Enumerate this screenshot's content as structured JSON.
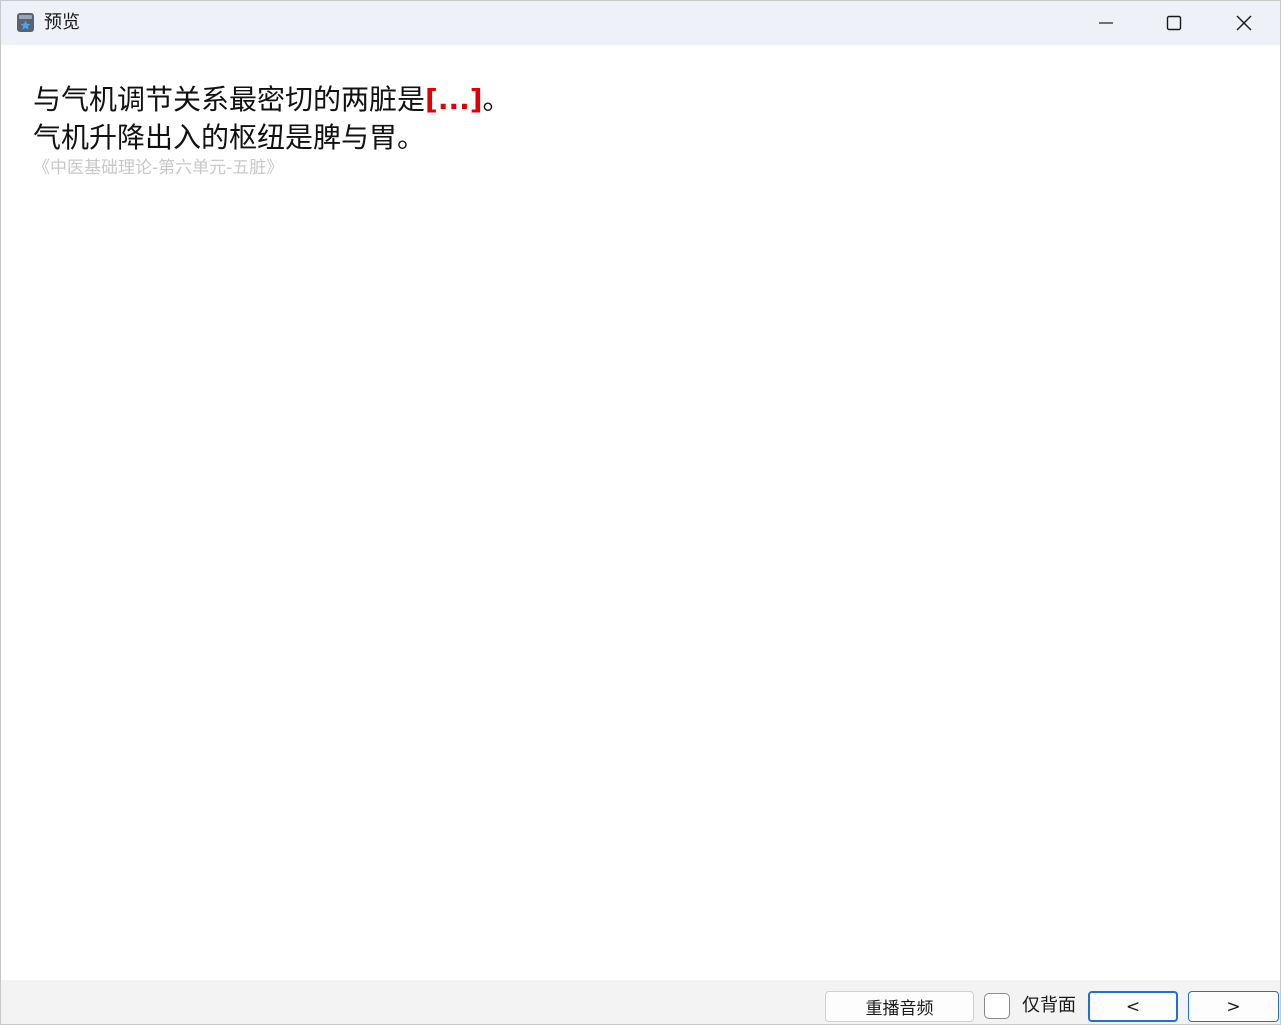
{
  "window": {
    "title": "预览",
    "app_icon": "star-app-icon",
    "controls": {
      "minimize_icon": "minimize-icon",
      "maximize_icon": "maximize-icon",
      "close_icon": "close-icon"
    }
  },
  "card": {
    "line1_before": "与气机调节关系最密切的两脏是",
    "cloze": "[...]",
    "line1_after": "。",
    "line2": "气机升降出入的枢纽是脾与胃。",
    "source": "《中医基础理论-第六单元-五脏》",
    "cloze_color": "#e00000"
  },
  "bottombar": {
    "replay_label": "重播音频",
    "back_only_label": "仅背面",
    "back_only_checked": false,
    "prev_label": "<",
    "next_label": ">"
  },
  "colors": {
    "titlebar_bg": "#eef1f8",
    "accent": "#1f6fd6",
    "source_text": "#c8c8c8"
  }
}
